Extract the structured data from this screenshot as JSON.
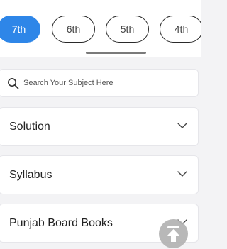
{
  "class_tabs": [
    {
      "label": "7th",
      "active": true
    },
    {
      "label": "6th",
      "active": false
    },
    {
      "label": "5th",
      "active": false
    },
    {
      "label": "4th",
      "active": false
    }
  ],
  "search": {
    "placeholder": "Search Your Subject Here",
    "value": "",
    "icon": "search-icon"
  },
  "sections": [
    {
      "label": "Solution",
      "icon": "chevron-down-icon"
    },
    {
      "label": "Syllabus",
      "icon": "chevron-down-icon"
    },
    {
      "label": "Punjab Board Books",
      "icon": "chevron-down-icon"
    }
  ],
  "scroll_top": {
    "icon": "arrow-up-to-top-icon"
  },
  "colors": {
    "accent": "#2e86e8",
    "background": "#f3f3f5",
    "card": "#ffffff",
    "text": "#222222"
  }
}
